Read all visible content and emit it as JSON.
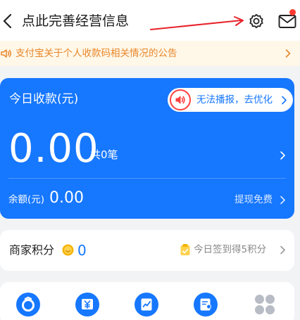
{
  "header": {
    "back_icon": "chevron-left-icon",
    "title": "点此完善经营信息",
    "settings_icon": "gear-icon",
    "messages_icon": "mail-icon",
    "annotation_arrow_color": "#e8222a"
  },
  "notice": {
    "icon": "speaker-icon",
    "text": "支付宝关于个人收款码相关情况的公告"
  },
  "income_card": {
    "title": "今日收款(元)",
    "alert_text": "无法播报，去优化",
    "amount": "0.00",
    "count_text": "共0笔",
    "balance_label": "余额(元)",
    "balance_value": "0.00",
    "withdraw_text": "提现免费"
  },
  "points": {
    "label": "商家积分",
    "value": "0",
    "signin_text": "今日签到得5积分"
  },
  "quick_actions": [
    {
      "icon": "qr-scan-icon"
    },
    {
      "icon": "yuan-shop-icon"
    },
    {
      "icon": "chart-clipboard-icon"
    },
    {
      "icon": "user-document-icon"
    },
    {
      "icon": "more-grid-icon"
    }
  ],
  "colors": {
    "brand_blue": "#1677ff",
    "notice_text": "#e8872a",
    "notice_bg": "#fff7e8",
    "alert_red": "#ff4040",
    "badge_red": "#ff3b30",
    "page_bg": "#f2f3f5"
  }
}
